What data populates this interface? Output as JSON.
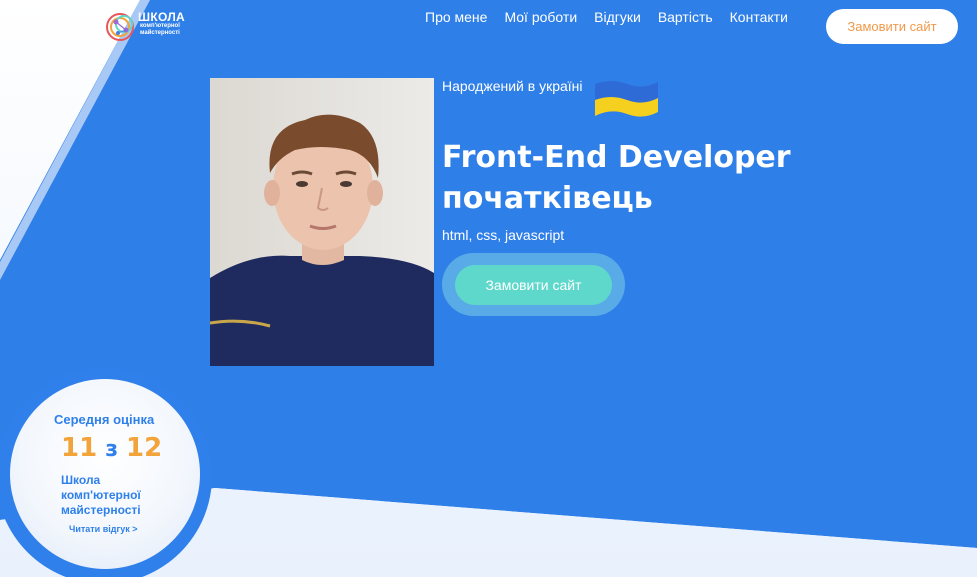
{
  "header": {
    "logo_text": "ШКОЛА",
    "logo_sub": "комп'ютерної майстерності",
    "nav": [
      {
        "label": "Про мене"
      },
      {
        "label": "Мої роботи"
      },
      {
        "label": "Відгуки"
      },
      {
        "label": "Вартість"
      },
      {
        "label": "Контакти"
      }
    ],
    "order_button": "Замовити сайт"
  },
  "hero": {
    "born": "Народжений в україні",
    "title_line1": "Front-End Developer",
    "title_line2": "початківець",
    "skills": "html, css, javascript",
    "cta": "Замовити сайт"
  },
  "rating": {
    "label": "Середня оцінка",
    "score": "11",
    "of": "з",
    "max": "12",
    "school": "Школа комп'ютерної майстерності",
    "read_link": "Читати відгук >"
  },
  "colors": {
    "brand_blue": "#2f7fe9",
    "accent_orange": "#f2994a",
    "teal": "#5fd8cc"
  }
}
